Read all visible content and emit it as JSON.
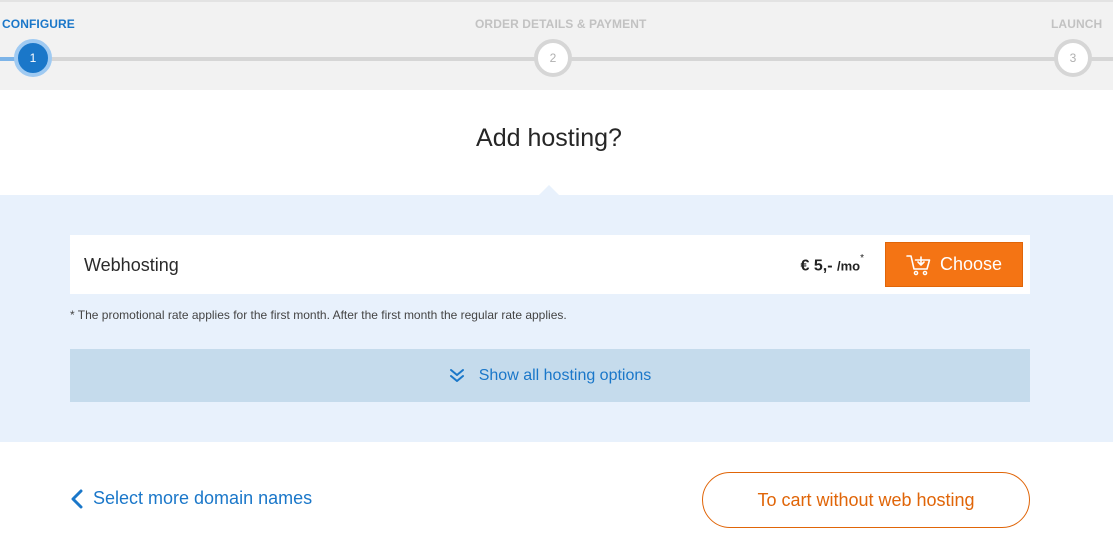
{
  "stepper": {
    "steps": [
      {
        "label": "CONFIGURE",
        "number": "1",
        "state": "active"
      },
      {
        "label": "ORDER DETAILS & PAYMENT",
        "number": "2",
        "state": "pending"
      },
      {
        "label": "LAUNCH",
        "number": "3",
        "state": "pending"
      }
    ]
  },
  "page": {
    "title": "Add hosting?"
  },
  "product": {
    "name": "Webhosting",
    "price": "€ 5,-",
    "unit": "/mo",
    "asterisk": "*",
    "choose_label": "Choose",
    "cart_icon": "cart-icon"
  },
  "footnote": "* The promotional rate applies for the first month. After the first month the regular rate applies.",
  "show_all": {
    "label": "Show all hosting options",
    "icon": "double-chevron-down-icon"
  },
  "actions": {
    "back_label": "Select more domain names",
    "back_icon": "chevron-left-icon",
    "cart_without_hosting_label": "To cart without web hosting"
  },
  "colors": {
    "accent_blue": "#1a77c9",
    "orange": "#f47414",
    "panel_bg": "#e8f1fc",
    "show_all_bg": "#c5dbec"
  }
}
